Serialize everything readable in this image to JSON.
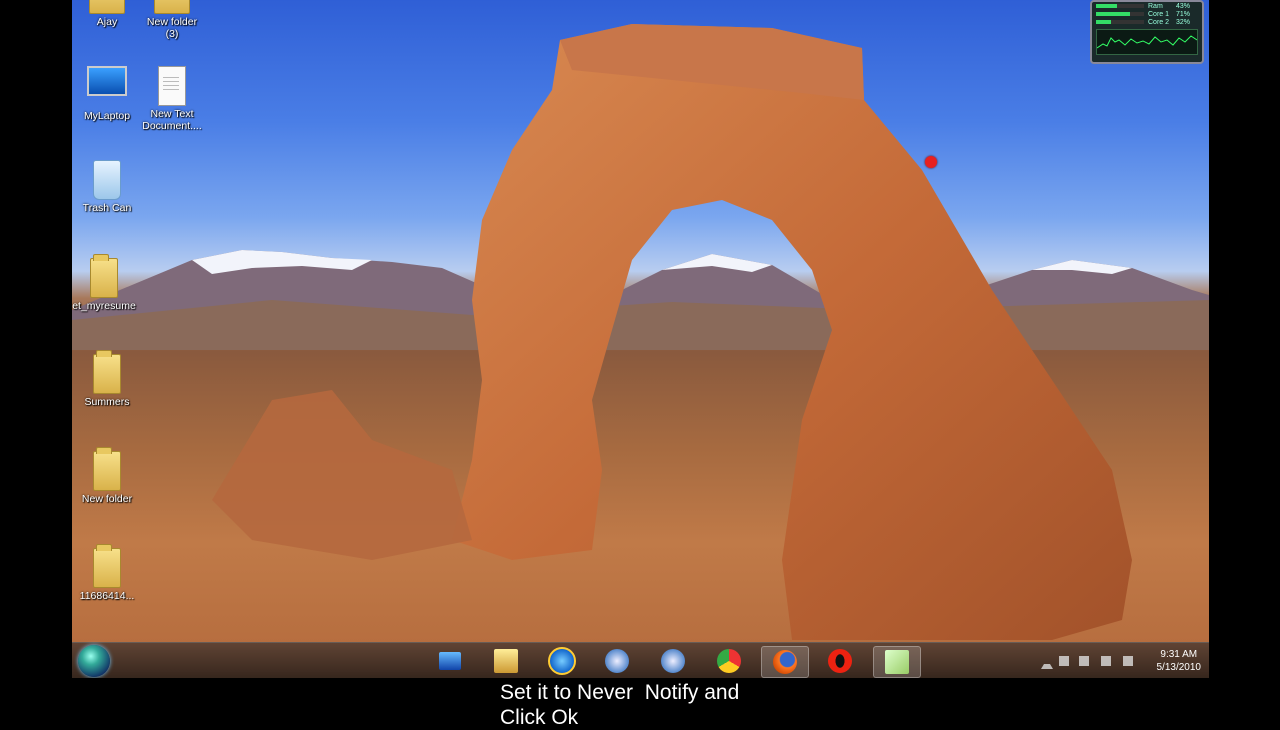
{
  "desktop": {
    "icons": [
      {
        "label": "Ajay",
        "kind": "folder"
      },
      {
        "label": "New folder\n(3)",
        "kind": "folder"
      },
      {
        "label": "MyLaptop",
        "kind": "monitor"
      },
      {
        "label": "New Text\nDocument....",
        "kind": "doc"
      },
      {
        "label": "Trash Can",
        "kind": "bin"
      },
      {
        "label": "et_myresume",
        "kind": "folder"
      },
      {
        "label": "Summers",
        "kind": "folder"
      },
      {
        "label": "New folder",
        "kind": "folder"
      },
      {
        "label": "11686414...",
        "kind": "folder"
      }
    ]
  },
  "gadget": {
    "rows": [
      {
        "label": "Ram",
        "value": "43%",
        "level": 0.43
      },
      {
        "label": "Core 1",
        "value": "71%",
        "level": 0.71
      },
      {
        "label": "Core 2",
        "value": "32%",
        "level": 0.32
      }
    ]
  },
  "taskbar": {
    "apps": [
      "computer-icon",
      "explorer-folder-icon",
      "internet-explorer-icon",
      "safari-icon",
      "safari-alt-icon",
      "chrome-icon",
      "firefox-icon",
      "opera-icon",
      "notepad-icon"
    ],
    "clock_time": "9:31 AM",
    "clock_date": "5/13/2010"
  },
  "caption": "Set it to Never  Notify and\nClick Ok"
}
